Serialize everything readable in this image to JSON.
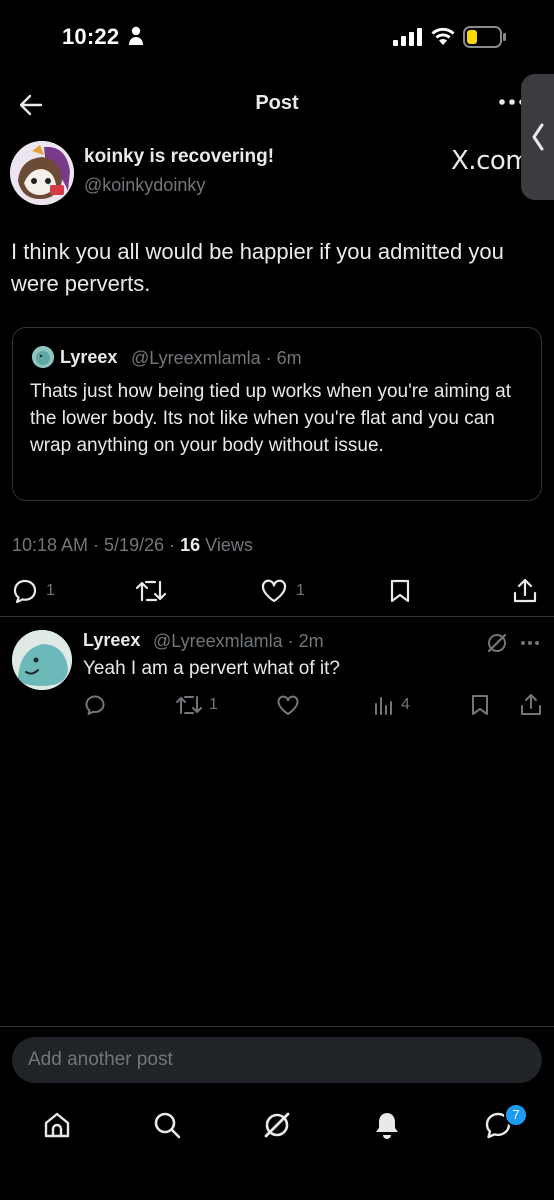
{
  "status": {
    "time": "10:22"
  },
  "header": {
    "title": "Post",
    "side_label": "X.com"
  },
  "post": {
    "author_name": "koinky is recovering!",
    "author_handle": "@koinkydoinky",
    "text": "I think you all would be happier if you admitted you were perverts.",
    "quote": {
      "name": "Lyreex",
      "meta": "@Lyreexmlamla · 6m",
      "text": "Thats just how being tied up works when you're aiming at the lower body. Its not like when you're flat and you can wrap anything on your body without issue."
    },
    "timestamp": "10:18 AM · 5/19/26 · ",
    "views_count": "16",
    "views_label": " Views",
    "actions": {
      "replies": "1",
      "reposts": "",
      "likes": "1"
    }
  },
  "reply": {
    "name": "Lyreex",
    "meta": "@Lyreexmlamla · 2m",
    "text": "Yeah I am a pervert what of it?",
    "reposts": "1",
    "views": "4"
  },
  "composer": {
    "placeholder": "Add another post"
  },
  "nav": {
    "messages_badge": "7"
  },
  "colors": {
    "accent": "#1d9bf0",
    "muted": "#71767b",
    "text": "#e7e9ea",
    "border": "#2f3336"
  }
}
